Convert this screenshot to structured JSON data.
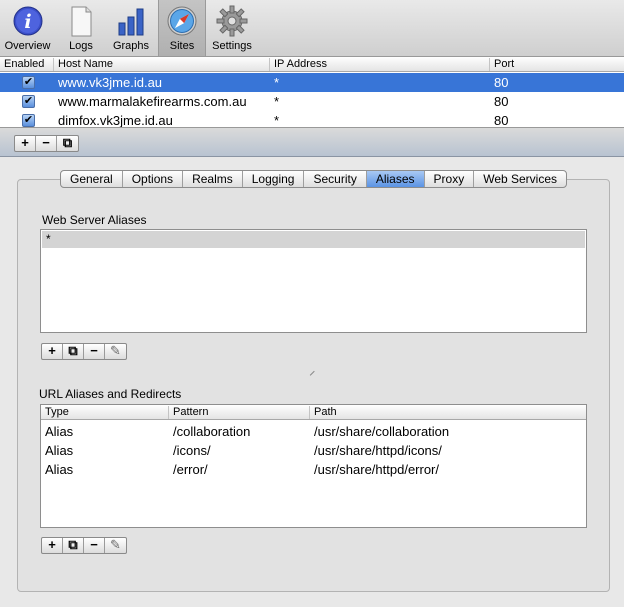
{
  "toolbar": {
    "items": [
      {
        "label": "Overview",
        "icon": "info-icon"
      },
      {
        "label": "Logs",
        "icon": "document-icon"
      },
      {
        "label": "Graphs",
        "icon": "bar-graph-icon"
      },
      {
        "label": "Sites",
        "icon": "compass-icon",
        "selected": true
      },
      {
        "label": "Settings",
        "icon": "gear-icon"
      }
    ]
  },
  "sites": {
    "columns": [
      "Enabled",
      "Host Name",
      "IP Address",
      "Port"
    ],
    "rows": [
      {
        "enabled": true,
        "host": "www.vk3jme.id.au",
        "ip": "*",
        "port": "80",
        "selected": true
      },
      {
        "enabled": true,
        "host": "www.marmalakefirearms.com.au",
        "ip": "*",
        "port": "80"
      },
      {
        "enabled": true,
        "host": "dimfox.vk3jme.id.au",
        "ip": "*",
        "port": "80"
      }
    ],
    "buttons": [
      "+",
      "−",
      "⧉"
    ]
  },
  "tabs": {
    "items": [
      "General",
      "Options",
      "Realms",
      "Logging",
      "Security",
      "Aliases",
      "Proxy",
      "Web Services"
    ],
    "active": "Aliases"
  },
  "web_server_aliases": {
    "label": "Web Server Aliases",
    "items": [
      "*"
    ],
    "buttons": [
      "+",
      "⧉",
      "−",
      "✎"
    ]
  },
  "url_aliases": {
    "label": "URL Aliases and Redirects",
    "columns": [
      "Type",
      "Pattern",
      "Path"
    ],
    "rows": [
      {
        "type": "Alias",
        "pattern": "/collaboration",
        "path": "/usr/share/collaboration"
      },
      {
        "type": "Alias",
        "pattern": "/icons/",
        "path": "/usr/share/httpd/icons/"
      },
      {
        "type": "Alias",
        "pattern": "/error/",
        "path": "/usr/share/httpd/error/"
      }
    ],
    "buttons": [
      "+",
      "⧉",
      "−",
      "✎"
    ]
  },
  "colors": {
    "selection": "#3875d7",
    "active_tab": "#5b93e4"
  }
}
